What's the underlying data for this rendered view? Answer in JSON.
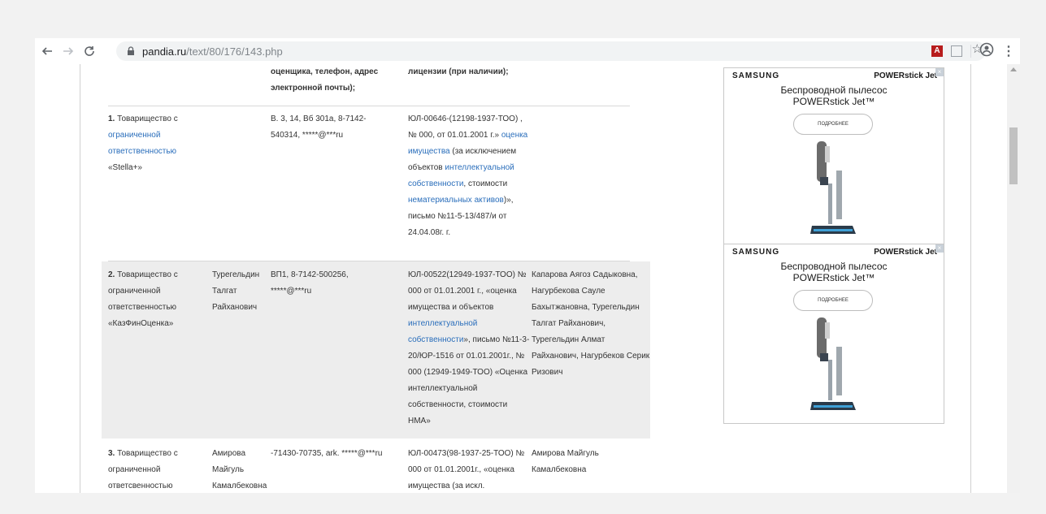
{
  "browser": {
    "url_host": "pandia.ru",
    "url_path": "/text/80/176/143.php"
  },
  "table": {
    "header": {
      "col3": "оценщика, телефон, адрес электронной почты);",
      "col4": "лицензии (при наличии);"
    },
    "rows": [
      {
        "num": "1.",
        "org_prefix": "Товарищество с",
        "org_link": "ограниченной ответственностью",
        "org_suffix": "«Stella+»",
        "director": "",
        "contacts": "В. 3, 14, Вб 301а, 8-7142-540314, *****@***ru",
        "license_a": "ЮЛ-00646-(12198-1937-ТОО) , № 000, от 01.01.2001 г.»",
        "license_link1": "оценка имущества",
        "license_b": "(за исключением объектов",
        "license_link2": "интеллектуальной собственности",
        "license_c": ", стоимости",
        "license_link3": "нематериальных активов",
        "license_d": ")», письмо №11-5-13/487/и от 24.04.08г. г.",
        "appraisers": ""
      },
      {
        "num": "2.",
        "org_prefix": "Товарищество с",
        "org_plain": "ограниченной ответственностью «КазФинОценка»",
        "director": "Турегельдин Талгат Райханович",
        "contacts": "ВП1, 8-7142-500256, *****@***ru",
        "license_a": "ЮЛ-00522(12949-1937-ТОО) № 000 от 01.01.2001 г., «оценка имущества и объектов",
        "license_link": "интеллектуальной собственности",
        "license_b": "», письмо №11-3-20/ЮР-1516 от 01.01.2001г., № 000 (12949-1949-ТОО) «Оценка интеллектуальной собственности, стоимости НМА»",
        "appraisers": "Капарова Аягоз Садыковна, Нагурбекова Сауле Бахытжановна, Турегельдин Талгат Райханович, Турегельдин Алмат Райханович, Нагурбеков Серик Ризович"
      },
      {
        "num": "3.",
        "org_prefix": "Товарищество с",
        "org_plain": "ограниченной ответсвенностью",
        "director": "Амирова Майгуль Камалбековна",
        "contacts": "-71430-70735, ark. *****@***ru",
        "license_a": "ЮЛ-00473(98-1937-25-ТОО) № 000 от 01.01.2001г., «оценка имущества (за искл.",
        "appraisers": "Амирова Майгуль Камалбековна"
      }
    ]
  },
  "ads": [
    {
      "brand": "SAMSUNG",
      "product": "POWERstick Jet",
      "title_line1": "Беспроводной пылесос",
      "title_line2": "POWERstick Jet™",
      "button": "ПОДРОБНЕЕ"
    },
    {
      "brand": "SAMSUNG",
      "product": "POWERstick Jet",
      "title_line1": "Беспроводной пылесос",
      "title_line2": "POWERstick Jet™",
      "button": "ПОДРОБНЕЕ"
    }
  ],
  "icons": [
    "back-icon",
    "forward-icon",
    "reload-icon",
    "lock-icon",
    "star-icon",
    "pdf-extension-icon",
    "extension-icon",
    "account-icon",
    "menu-icon"
  ]
}
